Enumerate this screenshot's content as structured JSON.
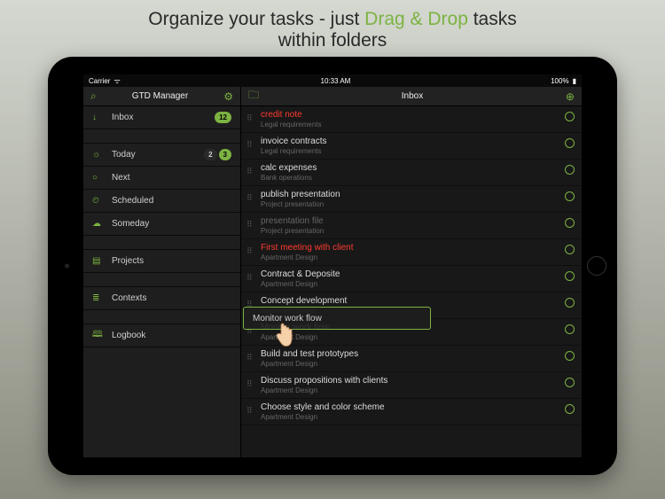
{
  "marketing": {
    "pre": "Organize your tasks - just ",
    "accent": "Drag & Drop",
    "post": " tasks",
    "line2": "within folders"
  },
  "status_bar": {
    "carrier": "Carrier",
    "wifi": "ᯤ",
    "time": "10:33 AM",
    "battery": "100%"
  },
  "sidebar": {
    "title": "GTD Manager",
    "search_icon": "⌕",
    "settings_icon": "⚙",
    "groups": [
      [
        {
          "icon": "↓",
          "label": "Inbox",
          "badge": "12"
        }
      ],
      [
        {
          "icon": "☼",
          "label": "Today",
          "badge_dark": "2",
          "badge": "3"
        },
        {
          "icon": "○",
          "label": "Next"
        },
        {
          "icon": "⏲",
          "label": "Scheduled"
        },
        {
          "icon": "☁",
          "label": "Someday"
        }
      ],
      [
        {
          "icon": "▤",
          "label": "Projects"
        }
      ],
      [
        {
          "icon": "≣",
          "label": "Contexts"
        }
      ],
      [
        {
          "icon": "🕮",
          "label": "Logbook"
        }
      ]
    ]
  },
  "main": {
    "folder_icon": "🗀",
    "title": "Inbox",
    "add_icon": "⊕",
    "tasks": [
      {
        "title": "credit note",
        "sub": "Legal requirements",
        "red": true
      },
      {
        "title": "invoice contracts",
        "sub": "Legal requirements"
      },
      {
        "title": "calc expenses",
        "sub": "Bank operations"
      },
      {
        "title": "publish presentation",
        "sub": "Project presentation"
      },
      {
        "title": "presentation file",
        "sub": "Project presentation",
        "dim": true
      },
      {
        "title": "First meeting with client",
        "sub": "Apartment Design",
        "red": true
      },
      {
        "title": "Contract & Deposite",
        "sub": "Apartment Design"
      },
      {
        "title": "Concept development",
        "sub": "Apartment Design"
      },
      {
        "title": "Monitor work flow",
        "sub": "Apartment Design"
      },
      {
        "title": "Build and test prototypes",
        "sub": "Apartment Design"
      },
      {
        "title": "Discuss propositions with clients",
        "sub": "Apartment Design"
      },
      {
        "title": "Choose style and color scheme",
        "sub": "Apartment Design"
      }
    ]
  },
  "drag_ghost": {
    "label": "Monitor work flow"
  }
}
